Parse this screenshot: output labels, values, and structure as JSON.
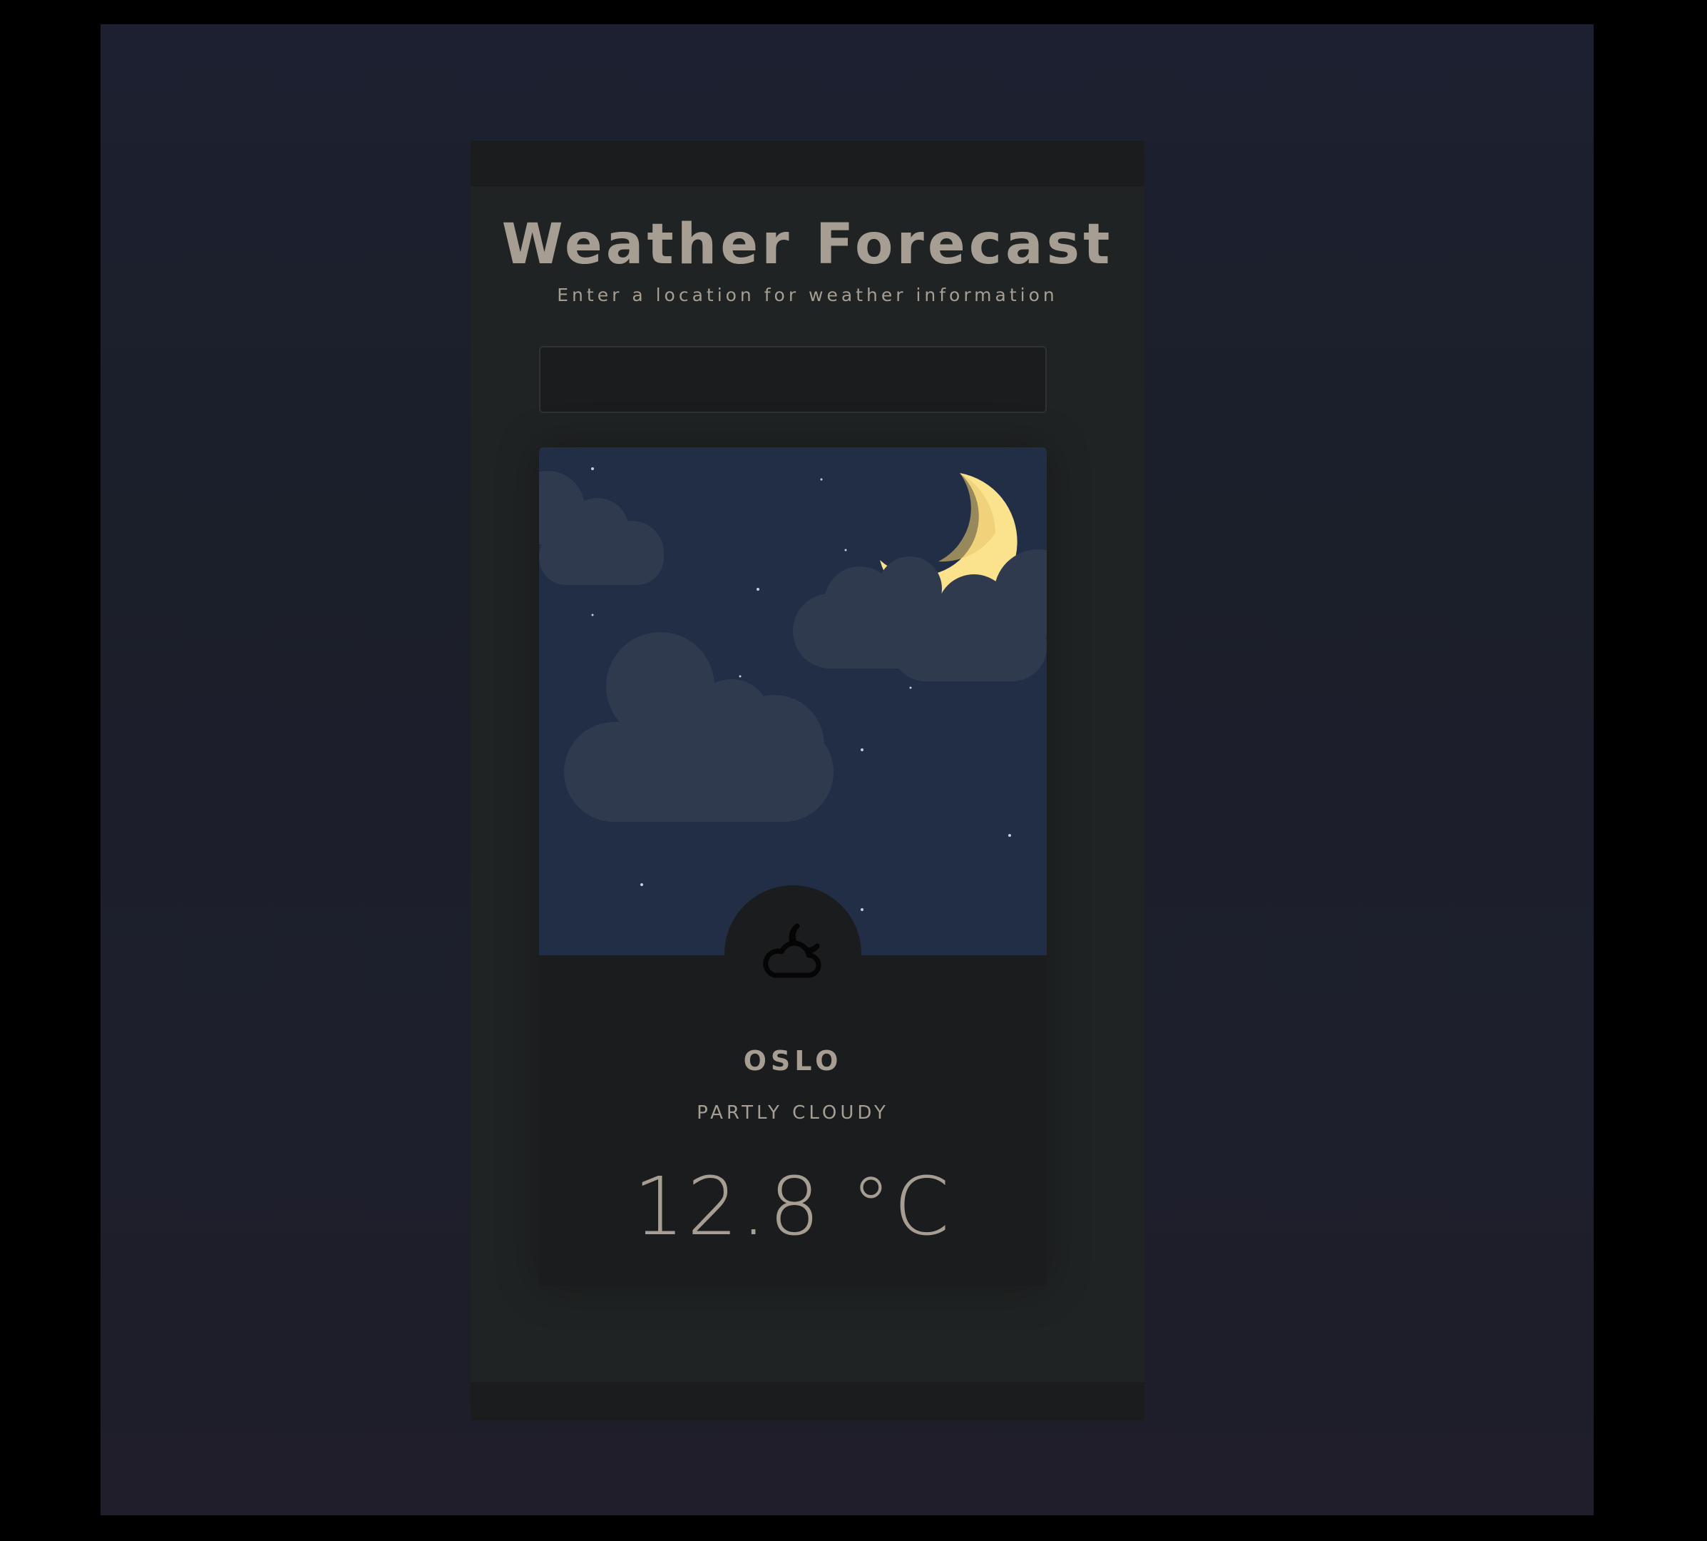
{
  "app": {
    "title": "Weather Forecast"
  },
  "search": {
    "label": "Enter a location for weather information",
    "value": "",
    "placeholder": ""
  },
  "weather": {
    "city": "OSLO",
    "condition": "PARTLY CLOUDY",
    "temperature": "12.8 °C",
    "icon": "moon-cloud-icon",
    "scene": "night-sky-with-moon-and-clouds"
  },
  "colors": {
    "page_background": "#1c2030",
    "panel_background": "#202323",
    "card_background": "#1b1c1e",
    "sky": "#222e46",
    "cloud": "#2f3a4f",
    "moon": "#fbe38e",
    "text": "#a69e92"
  }
}
